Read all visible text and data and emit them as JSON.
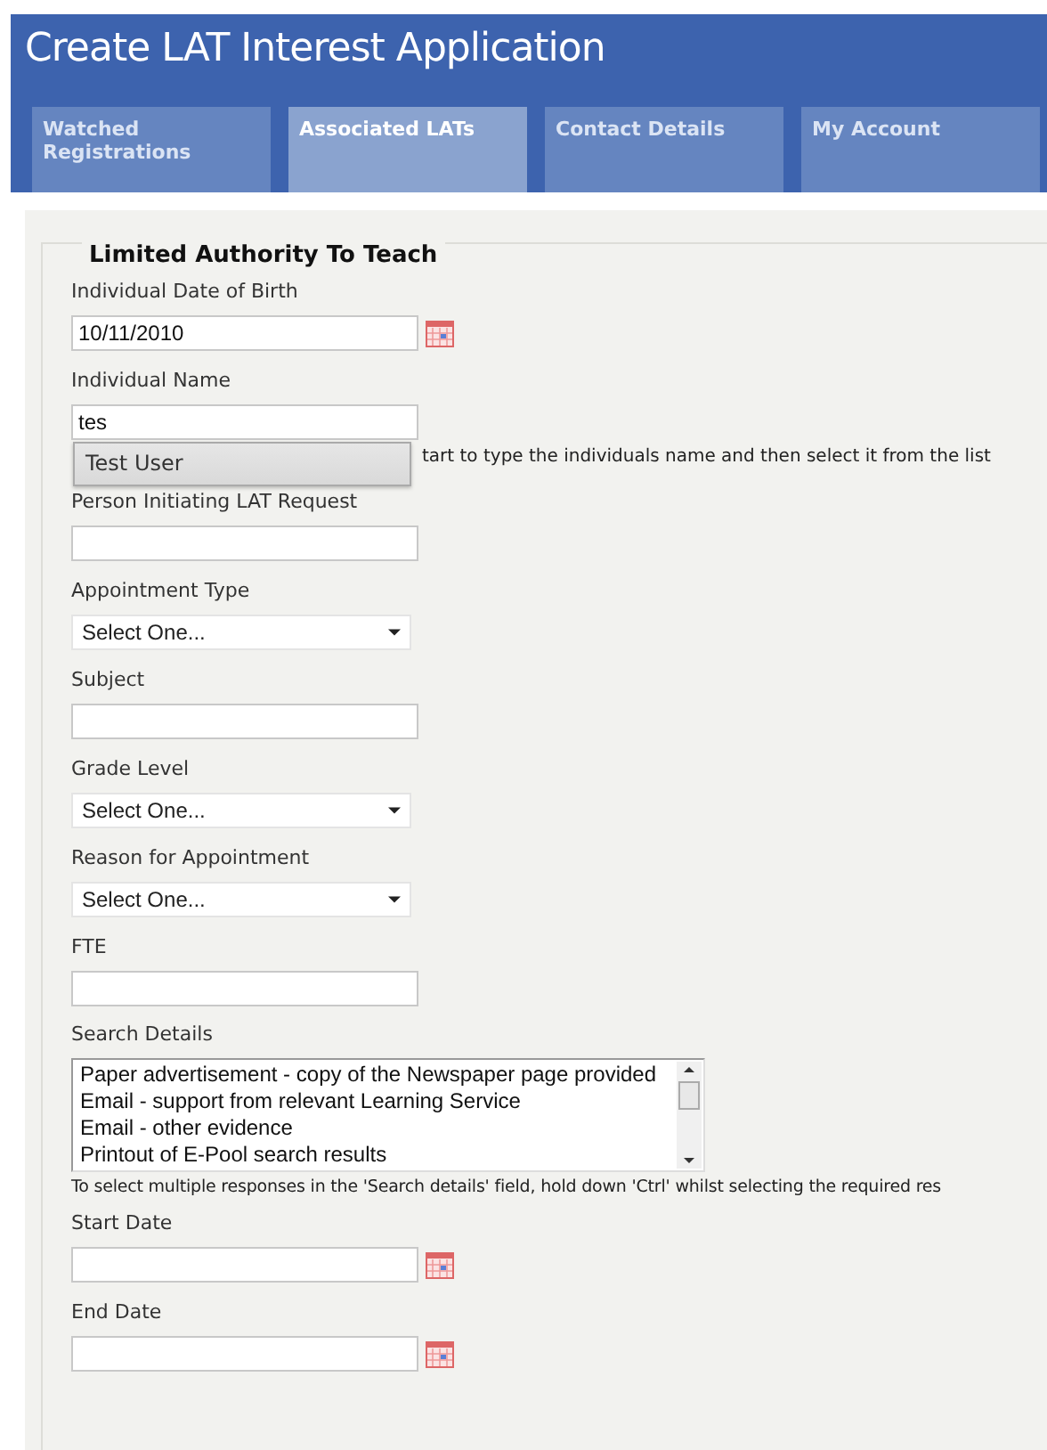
{
  "window": {
    "title": "Create LAT Interest Application"
  },
  "tabs": [
    {
      "label": "Watched Registrations",
      "selected": false
    },
    {
      "label": "Associated LATs",
      "selected": true
    },
    {
      "label": "Contact Details",
      "selected": false
    },
    {
      "label": "My Account",
      "selected": false
    }
  ],
  "form": {
    "legend": "Limited Authority To Teach",
    "fields": [
      {
        "kind": "date",
        "label": "Individual Date of Birth",
        "value": "10/11/2010"
      },
      {
        "kind": "autocomplete",
        "label": "Individual Name",
        "value": "tes",
        "suggestion": "Test User",
        "hint": "tart to type the individuals name and then select it from the list"
      },
      {
        "kind": "text",
        "label": "Person Initiating LAT Request"
      },
      {
        "kind": "select",
        "label": "Appointment Type",
        "value": "Select One..."
      },
      {
        "kind": "text",
        "label": "Subject"
      },
      {
        "kind": "select",
        "label": "Grade Level",
        "value": "Select One..."
      },
      {
        "kind": "select",
        "label": "Reason for Appointment",
        "value": "Select One..."
      },
      {
        "kind": "text",
        "label": "FTE"
      },
      {
        "kind": "listbox",
        "label": "Search Details",
        "options": [
          "Paper advertisement - copy of the Newspaper page provided",
          "Email - support from relevant Learning Service",
          "Email - other evidence",
          "Printout of E-Pool search results"
        ],
        "note": "To select multiple responses in the 'Search details' field, hold down 'Ctrl' whilst selecting the required res"
      },
      {
        "kind": "date",
        "label": "Start Date"
      },
      {
        "kind": "date",
        "label": "End Date"
      }
    ]
  }
}
